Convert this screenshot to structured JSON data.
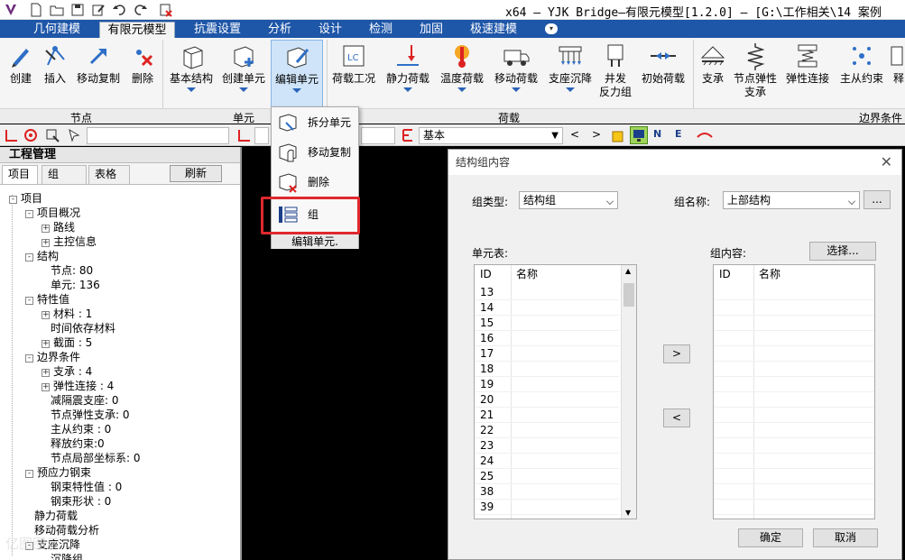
{
  "titlebar": {
    "title": "x64 – YJK Bridge–有限元模型[1.2.0] – [G:\\工作相关\\14 案例"
  },
  "menu": {
    "tabs": [
      "几何建模",
      "有限元模型",
      "抗震设置",
      "分析",
      "设计",
      "检测",
      "加固",
      "极速建模"
    ]
  },
  "ribbon": {
    "buttons": [
      "创建",
      "插入",
      "移动复制",
      "删除",
      "基本结构",
      "创建单元",
      "编辑单元",
      "荷载工况",
      "静力荷载",
      "温度荷载",
      "移动荷载",
      "支座沉降",
      "井发\n反力组",
      "初始荷载",
      "支承",
      "节点弹性\n支承",
      "弹性连接",
      "主从约束",
      "释"
    ],
    "groups": [
      "节点",
      "单元",
      "荷载",
      "边界条件"
    ]
  },
  "toolbar": {
    "combo_value": "基本"
  },
  "popup": {
    "items": [
      "拆分单元",
      "移动复制",
      "删除",
      "组"
    ],
    "footer": "编辑单元."
  },
  "left_panel": {
    "title": "工程管理",
    "tabs": [
      "项目",
      "组",
      "表格"
    ],
    "refresh": "刷新",
    "tree": [
      {
        "text": "项目",
        "level": 0,
        "pm": "-"
      },
      {
        "text": "项目概况",
        "level": 1,
        "pm": "-"
      },
      {
        "text": "路线",
        "level": 2,
        "pm": "+"
      },
      {
        "text": "主控信息",
        "level": 2,
        "pm": "+"
      },
      {
        "text": "结构",
        "level": 1,
        "pm": "-"
      },
      {
        "text": "节点: 80",
        "level": 2,
        "pm": ""
      },
      {
        "text": "单元: 136",
        "level": 2,
        "pm": ""
      },
      {
        "text": "特性值",
        "level": 1,
        "pm": "-"
      },
      {
        "text": "材料 : 1",
        "level": 2,
        "pm": "+"
      },
      {
        "text": "时间依存材料",
        "level": 2,
        "pm": ""
      },
      {
        "text": "截面 : 5",
        "level": 2,
        "pm": "+"
      },
      {
        "text": "边界条件",
        "level": 1,
        "pm": "-"
      },
      {
        "text": "支承 : 4",
        "level": 2,
        "pm": "+"
      },
      {
        "text": "弹性连接 : 4",
        "level": 2,
        "pm": "+"
      },
      {
        "text": "减隔震支座: 0",
        "level": 2,
        "pm": ""
      },
      {
        "text": "节点弹性支承: 0",
        "level": 2,
        "pm": ""
      },
      {
        "text": "主从约束 : 0",
        "level": 2,
        "pm": ""
      },
      {
        "text": "释放约束:0",
        "level": 2,
        "pm": ""
      },
      {
        "text": "节点局部坐标系: 0",
        "level": 2,
        "pm": ""
      },
      {
        "text": "预应力钢束",
        "level": 1,
        "pm": "-"
      },
      {
        "text": "钢束特性值 : 0",
        "level": 2,
        "pm": ""
      },
      {
        "text": "钢束形状 : 0",
        "level": 2,
        "pm": ""
      },
      {
        "text": "静力荷载",
        "level": 1,
        "pm": ""
      },
      {
        "text": "移动荷载分析",
        "level": 1,
        "pm": ""
      },
      {
        "text": "支座沉降",
        "level": 1,
        "pm": "-"
      },
      {
        "text": "沉降组",
        "level": 2,
        "pm": ""
      }
    ]
  },
  "dialog": {
    "title": "结构组内容",
    "group_type_label": "组类型:",
    "group_type_value": "结构组",
    "group_name_label": "组名称:",
    "group_name_value": "上部结构",
    "more_button": "...",
    "unit_table_label": "单元表:",
    "group_content_label": "组内容:",
    "select_button": "选择...",
    "col_id": "ID",
    "col_name": "名称",
    "unit_ids": [
      "13",
      "14",
      "15",
      "16",
      "17",
      "18",
      "19",
      "20",
      "21",
      "22",
      "23",
      "24",
      "25",
      "38",
      "39"
    ],
    "add_button": ">",
    "remove_button": "<",
    "ok_button": "确定",
    "cancel_button": "取消"
  },
  "watermark": "亿图图示"
}
